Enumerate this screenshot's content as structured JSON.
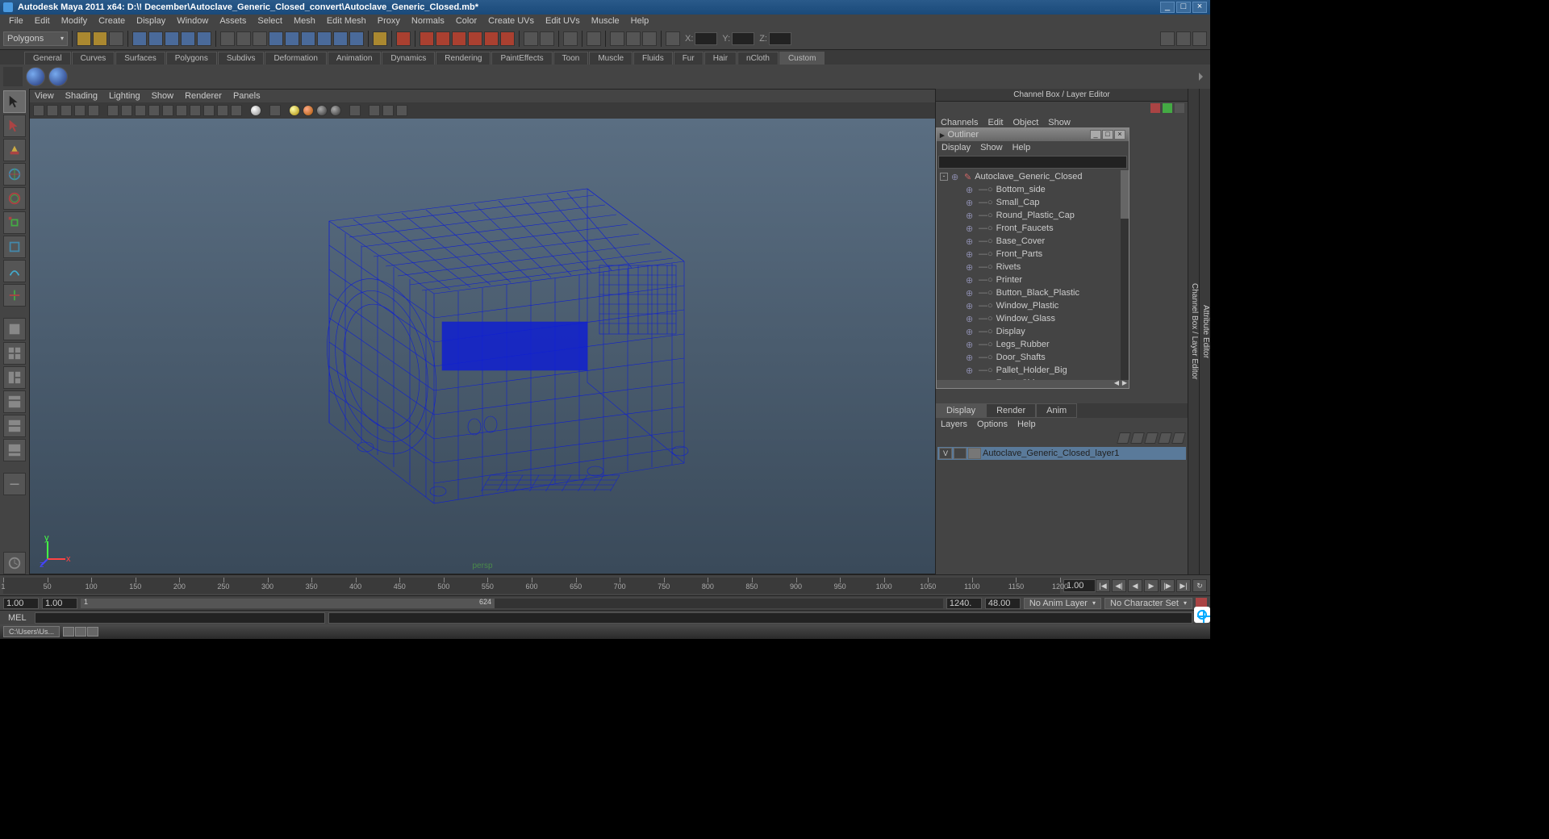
{
  "title": "Autodesk Maya 2011 x64: D:\\! December\\Autoclave_Generic_Closed_convert\\Autoclave_Generic_Closed.mb*",
  "menubar": [
    "File",
    "Edit",
    "Modify",
    "Create",
    "Display",
    "Window",
    "Assets",
    "Select",
    "Mesh",
    "Edit Mesh",
    "Proxy",
    "Normals",
    "Color",
    "Create UVs",
    "Edit UVs",
    "Muscle",
    "Help"
  ],
  "statusCombo": "Polygons",
  "coords": {
    "x": "X:",
    "y": "Y:",
    "z": "Z:"
  },
  "shelfTabs": [
    "General",
    "Curves",
    "Surfaces",
    "Polygons",
    "Subdivs",
    "Deformation",
    "Animation",
    "Dynamics",
    "Rendering",
    "PaintEffects",
    "Toon",
    "Muscle",
    "Fluids",
    "Fur",
    "Hair",
    "nCloth",
    "Custom"
  ],
  "shelfActive": "Custom",
  "viewportMenu": [
    "View",
    "Shading",
    "Lighting",
    "Show",
    "Renderer",
    "Panels"
  ],
  "perspLabel": "persp",
  "channelBox": {
    "title": "Channel Box / Layer Editor",
    "menu": [
      "Channels",
      "Edit",
      "Object",
      "Show"
    ]
  },
  "outliner": {
    "title": "Outliner",
    "menu": [
      "Display",
      "Show",
      "Help"
    ],
    "root": "Autoclave_Generic_Closed",
    "items": [
      "Bottom_side",
      "Small_Cap",
      "Round_Plastic_Cap",
      "Front_Faucets",
      "Base_Cover",
      "Front_Parts",
      "Rivets",
      "Printer",
      "Button_Black_Plastic",
      "Window_Plastic",
      "Window_Glass",
      "Display",
      "Legs_Rubber",
      "Door_Shafts",
      "Pallet_Holder_Big",
      "Front_Side"
    ]
  },
  "layers": {
    "tabs": [
      "Display",
      "Render",
      "Anim"
    ],
    "active": "Display",
    "menu": [
      "Layers",
      "Options",
      "Help"
    ],
    "layer1": {
      "vis": "V",
      "name": "Autoclave_Generic_Closed_layer1"
    }
  },
  "sideTabs": [
    "Channel Box / Layer Editor",
    "Attribute Editor"
  ],
  "timeline": {
    "ticks": [
      "1",
      "50",
      "100",
      "150",
      "200",
      "250",
      "300",
      "350",
      "400",
      "450",
      "500",
      "550",
      "600",
      "650",
      "700",
      "750",
      "800",
      "850",
      "900",
      "950",
      "1000",
      "1050",
      "1100",
      "1150",
      "1200"
    ],
    "curFrame": "1.00"
  },
  "range": {
    "start": "1.00",
    "innerStart": "1.00",
    "sliderStart": "1",
    "sliderEnd": "624",
    "end": "1240.",
    "max": "48.00",
    "animLayer": "No Anim Layer",
    "charSet": "No Character Set"
  },
  "cmd": {
    "label": "MEL"
  },
  "task": "C:\\Users\\Us..."
}
